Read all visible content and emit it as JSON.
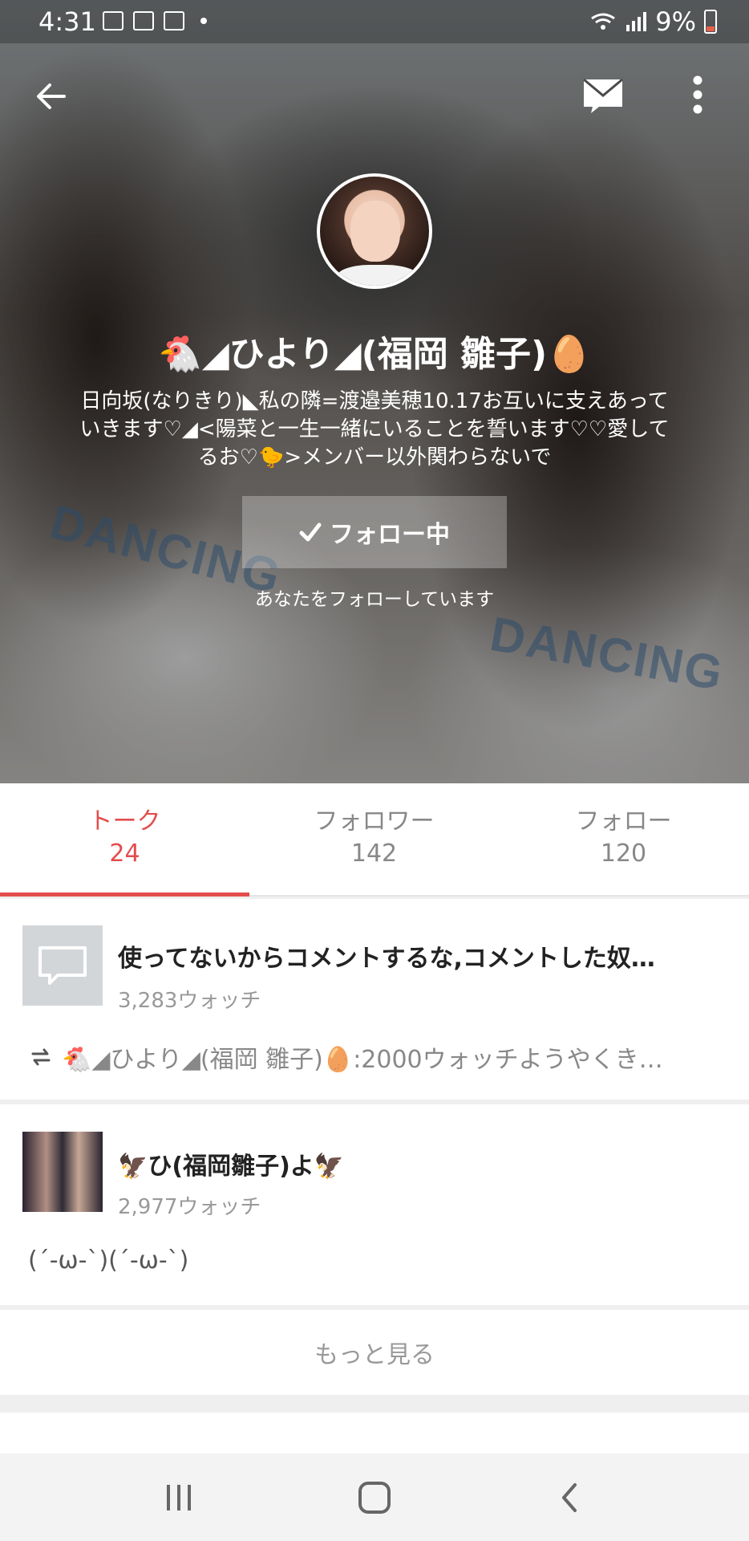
{
  "status_bar": {
    "time": "4:31",
    "battery": "9%"
  },
  "header": {
    "back_icon": "arrow-left-icon",
    "message_icon": "mail-icon",
    "more_icon": "more-vertical-icon"
  },
  "profile": {
    "name": "🐔◢ひより◢(福岡 雛子)🥚",
    "bio": "日向坂(なりきり)◣私の隣=渡邉美穂10.17お互いに支えあっていきます♡◢<陽菜と一生一緒にいることを誓います♡♡愛してるお♡🐤>メンバー以外関わらないで",
    "follow_button": "フォロー中",
    "follows_you": "あなたをフォローしています"
  },
  "tabs": [
    {
      "label": "トーク",
      "count": "24"
    },
    {
      "label": "フォロワー",
      "count": "142"
    },
    {
      "label": "フォロー",
      "count": "120"
    }
  ],
  "talks": [
    {
      "title": "使ってないからコメントするな,コメントした奴…",
      "watch": "3,283ウォッチ",
      "latest": "🐔◢ひより◢(福岡 雛子)🥚:2000ウォッチようやくき…"
    },
    {
      "title": "🦅ひ(福岡雛子)よ🦅",
      "watch": "2,977ウォッチ",
      "latest": "(´-ω-`)(´-ω-`)"
    }
  ],
  "more_label": "もっと見る",
  "colors": {
    "accent": "#e34d4d",
    "muted_text": "#999999"
  }
}
